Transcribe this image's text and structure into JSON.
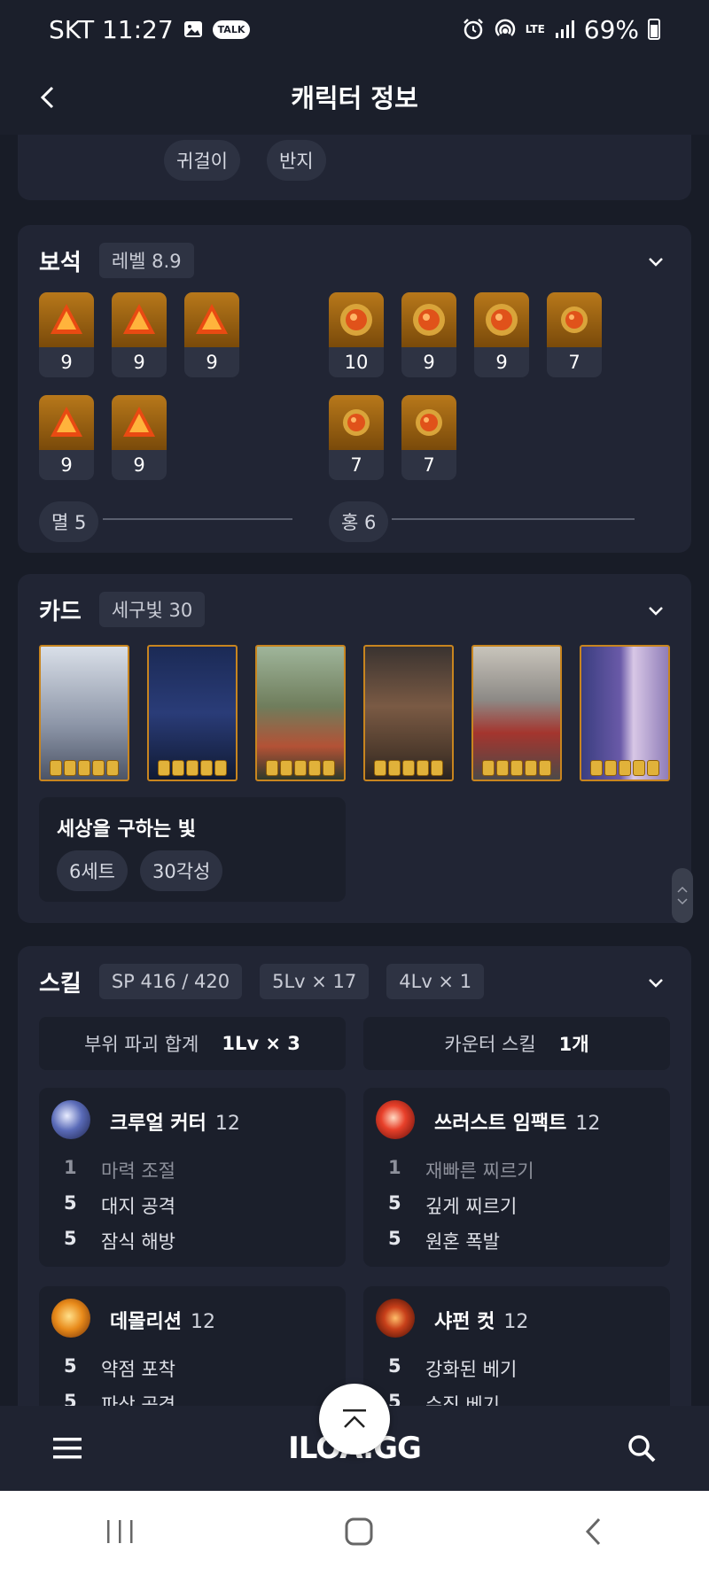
{
  "status_bar": {
    "carrier_time": "SKT 11:27",
    "talk_badge": "TALK",
    "network": "LTE",
    "battery": "69%"
  },
  "header": {
    "title": "캐릭터 정보"
  },
  "accessories": {
    "items": [
      "귀걸이",
      "반지"
    ]
  },
  "gems": {
    "title": "보석",
    "level_tag": "레벨 8.9",
    "left_row1": [
      "9",
      "9",
      "9"
    ],
    "left_row2": [
      "9",
      "9"
    ],
    "right_row1": [
      "10",
      "9",
      "9",
      "7"
    ],
    "right_row2": [
      "7",
      "7"
    ],
    "left_group": "멸 5",
    "right_group": "홍 6"
  },
  "cards": {
    "title": "카드",
    "set_tag": "세구빛 30",
    "card_count": 6,
    "awaken_per_card": 5,
    "set_name": "세상을 구하는 빛",
    "set_pills": [
      "6세트",
      "30각성"
    ]
  },
  "skills": {
    "title": "스킬",
    "tags": [
      "SP 416 / 420",
      "5Lv × 17",
      "4Lv × 1"
    ],
    "summary": [
      {
        "key": "부위 파괴 합계",
        "value": "1Lv × 3"
      },
      {
        "key": "카운터 스킬",
        "value": "1개"
      }
    ],
    "list": [
      {
        "name": "크루얼 커터",
        "level": "12",
        "tripods": [
          {
            "n": "1",
            "t": "마력 조절",
            "dim": true
          },
          {
            "n": "5",
            "t": "대지 공격",
            "dim": false
          },
          {
            "n": "5",
            "t": "잠식 해방",
            "dim": false
          }
        ]
      },
      {
        "name": "쓰러스트 임팩트",
        "level": "12",
        "tripods": [
          {
            "n": "1",
            "t": "재빠른 찌르기",
            "dim": true
          },
          {
            "n": "5",
            "t": "깊게 찌르기",
            "dim": false
          },
          {
            "n": "5",
            "t": "원혼 폭발",
            "dim": false
          }
        ]
      },
      {
        "name": "데몰리션",
        "level": "12",
        "tripods": [
          {
            "n": "5",
            "t": "약점 포착",
            "dim": false
          },
          {
            "n": "5",
            "t": "파상 공격",
            "dim": false
          }
        ]
      },
      {
        "name": "샤펀 컷",
        "level": "12",
        "tripods": [
          {
            "n": "5",
            "t": "강화된 베기",
            "dim": false
          },
          {
            "n": "5",
            "t": "수직 베기",
            "dim": false
          }
        ]
      }
    ]
  },
  "app_bar": {
    "logo": "ILOA.GG"
  },
  "icons": {
    "back": "chevron-left-icon",
    "expand": "chevron-down-icon",
    "menu": "hamburger-menu-icon",
    "search": "search-icon",
    "to_top": "chevron-up-icon"
  },
  "colors": {
    "background": "#181c27",
    "card": "#212534",
    "gem_gold": "#b8781a",
    "card_border": "#c8851f"
  }
}
